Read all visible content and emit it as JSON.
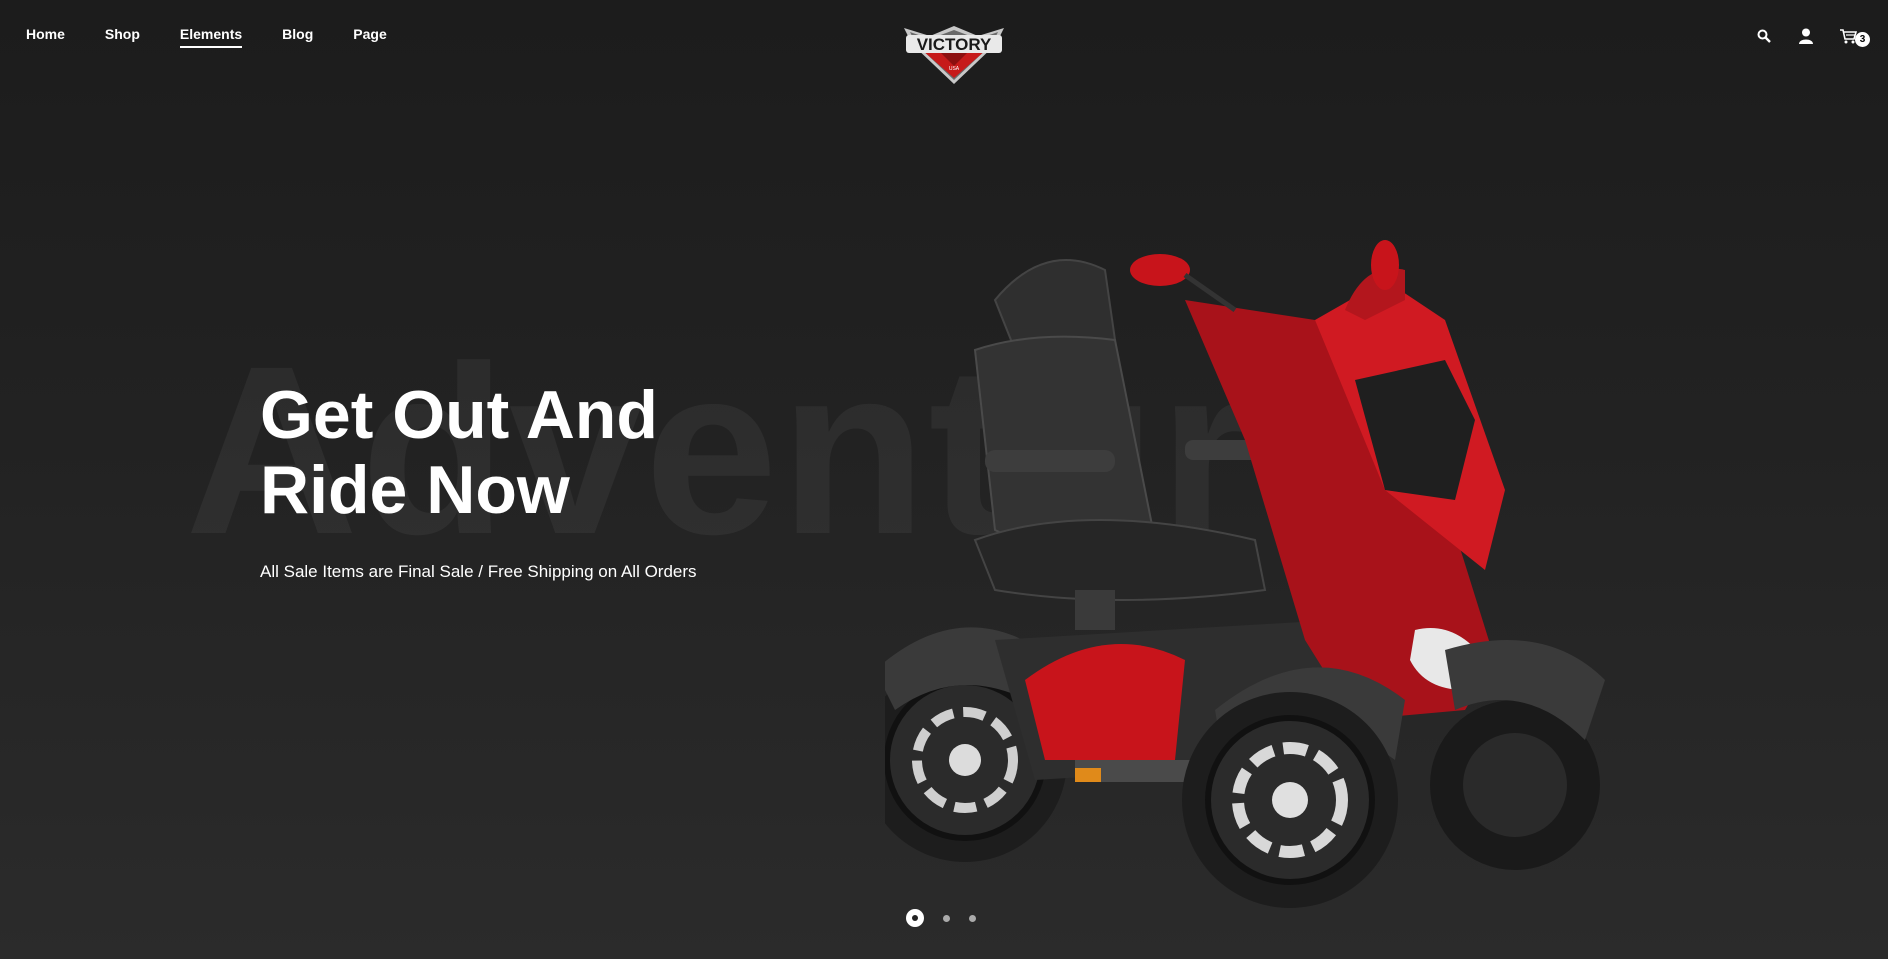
{
  "nav": {
    "items": [
      {
        "label": "Home",
        "active": false
      },
      {
        "label": "Shop",
        "active": false
      },
      {
        "label": "Elements",
        "active": true
      },
      {
        "label": "Blog",
        "active": false
      },
      {
        "label": "Page",
        "active": false
      }
    ]
  },
  "logo": {
    "text": "VICTORY",
    "subtext": "USA"
  },
  "header_tools": {
    "icons": [
      "search-icon",
      "user-icon",
      "cart-icon"
    ],
    "cart_count": "3"
  },
  "hero": {
    "background_word": "Adventure",
    "headline_line1": "Get Out And",
    "headline_line2": "Ride Now",
    "subtitle": "All Sale Items are Final Sale / Free Shipping on All Orders",
    "product_image": "red-mobility-scooter"
  },
  "slider": {
    "total": 3,
    "active_index": 0
  },
  "colors": {
    "accent": "#d0101a",
    "background": "#222222",
    "text": "#ffffff"
  }
}
